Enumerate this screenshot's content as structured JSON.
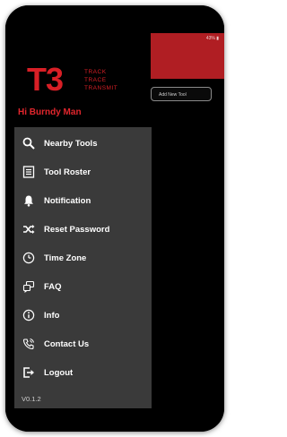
{
  "status": {
    "battery_text": "43% ▮"
  },
  "background": {
    "add_tool_label": "Add New Tool"
  },
  "logo": {
    "mark": "T3",
    "lines": [
      "TRACK",
      "TRACE",
      "TRANSMIT"
    ]
  },
  "greeting": "Hi Burndy Man",
  "menu": {
    "items": [
      {
        "label": "Nearby Tools",
        "icon": "search-icon"
      },
      {
        "label": "Tool Roster",
        "icon": "list-icon"
      },
      {
        "label": "Notification",
        "icon": "bell-icon"
      },
      {
        "label": "Reset Password",
        "icon": "shuffle-icon"
      },
      {
        "label": "Time Zone",
        "icon": "clock-icon"
      },
      {
        "label": "FAQ",
        "icon": "faq-icon"
      },
      {
        "label": "Info",
        "icon": "info-icon"
      },
      {
        "label": "Contact Us",
        "icon": "phone-icon"
      },
      {
        "label": "Logout",
        "icon": "logout-icon"
      }
    ],
    "version": "V0.1.2"
  },
  "colors": {
    "brand_red": "#d81f26",
    "header_red": "#b01e23",
    "drawer_gray": "#3a3a3a"
  }
}
